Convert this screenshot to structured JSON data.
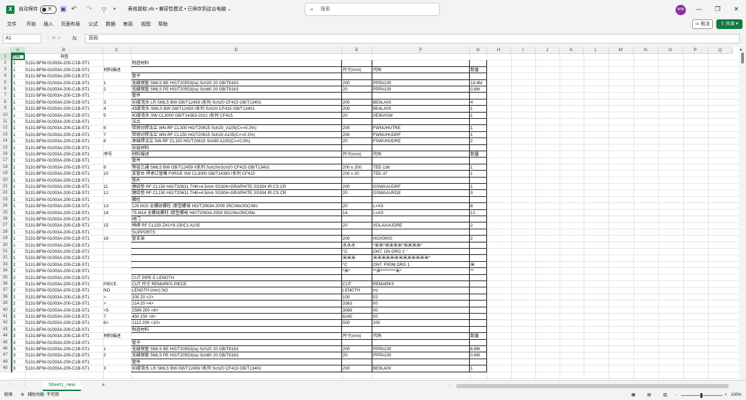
{
  "titlebar": {
    "app_logo": "X",
    "autosave_label": "自动保存",
    "autosave_state": "关",
    "filename": "表格提取.xls",
    "mode": "兼容性模式",
    "save_status": "已保存到这台电脑",
    "title_sep": "•",
    "search_placeholder": "搜索",
    "avatar_initials": "WW",
    "icons": [
      "save-icon",
      "undo-icon",
      "redo-icon",
      "filter-icon",
      "customize-icon",
      "minimize-icon",
      "restore-icon",
      "close-icon"
    ]
  },
  "menu": {
    "items": [
      "文件",
      "开始",
      "插入",
      "页面布局",
      "公式",
      "数据",
      "审阅",
      "视图",
      "帮助"
    ],
    "comment_btn": "批注",
    "share_btn": "共享"
  },
  "formula": {
    "namebox": "A1",
    "value": "页码"
  },
  "columns": [
    "A",
    "B",
    "C",
    "D",
    "E",
    "F",
    "G",
    "H",
    "I",
    "J",
    "K",
    "L",
    "M",
    "N",
    "O",
    "P",
    "Q"
  ],
  "rows": [
    [
      "页码",
      "书签",
      "",
      "",
      "",
      "",
      ""
    ],
    [
      "1",
      "5131-BFW-01003A-200-C1B-ST1",
      "",
      "制造材料",
      "",
      "",
      ""
    ],
    [
      "1",
      "5131-BFW-01003A-200-C1B-ST1",
      "材料描述",
      "",
      "尺寸(mm)",
      "代码",
      "数量"
    ],
    [
      "1",
      "5131-BFW-01003A-200-C1B-ST1",
      "",
      "管子",
      "",
      "",
      ""
    ],
    [
      "1",
      "5131-BFW-01003A-200-C1B-ST1",
      "1",
      "无缝钢管 SMLS BE HG/T20553(Ia) Sch20 20 GB/T8163",
      "200",
      "PPPA100",
      "18.4M"
    ],
    [
      "1",
      "5131-BFW-01003A-200-C1B-ST1",
      "2",
      "无缝钢管 SMLS PE HG/T20553(Ia) Sch80 20 GB/T8163",
      "20",
      "PPPA100",
      "0.6M"
    ],
    [
      "1",
      "5131-BFW-01003A-200-C1B-ST1",
      "",
      "管件",
      "",
      "",
      ""
    ],
    [
      "1",
      "5131-BFW-01003A-200-C1B-ST1",
      "3",
      "90度弯头 LR SMLS BW GB/T12459 I系列 Sch20 CF415 GB/T13401",
      "200",
      "BE9LA00",
      "4"
    ],
    [
      "1",
      "5131-BFW-01003A-200-C1B-ST1",
      "4",
      "45度弯头 SMLS BW GB/T12459 I系列 Sch20 CF415 GB/T13401",
      "200",
      "BE4LA00",
      "1"
    ],
    [
      "1",
      "5131-BFW-01003A-200-C1B-ST1",
      "5",
      "90度弯头 SW CL3000 GB/T14383-2021 I系列 CF415",
      "20",
      "0E90ASW",
      "1"
    ],
    [
      "1",
      "5131-BFW-01003A-200-C1B-ST1",
      "",
      "法兰",
      "",
      "",
      ""
    ],
    [
      "1",
      "5131-BFW-01003A-200-C1B-ST1",
      "6",
      "带颈对焊法兰 WN-RF CL300 HG/T20615 Sch20_A105(C<=0.3%)",
      "200",
      "FWNUHUTRE",
      "1"
    ],
    [
      "1",
      "5131-BFW-01003A-200-C1B-ST1",
      "7",
      "带颈对焊法兰 WN-RF CL150 HG/T20615 Sch20 A105(C<=0.3%)",
      "200",
      "FWNUHUDRF",
      "1"
    ],
    [
      "1",
      "5131-BFW-01003A-200-C1B-ST1",
      "8",
      "承插焊法兰 SW-RF CL150 HG/T20615 Sch80 A105(C<=0.3%)",
      "20",
      "FSWUHUDRE",
      "2"
    ],
    [
      "1",
      "5131-BFW-01003A-200-C1B-ST1",
      "",
      "安装材料",
      "",
      "",
      ""
    ],
    [
      "1",
      "5131-BFW-01003A-200-C1B-ST1",
      "序号",
      "材料描述",
      "尺寸(mm)",
      "代码",
      "数量"
    ],
    [
      "1",
      "5131-BFW-01003A-200-C1B-ST1",
      "",
      "管件",
      "",
      "",
      ""
    ],
    [
      "1",
      "5131-BFW-01003A-200-C1B-ST1",
      "9",
      "等径三通 SMLS BW GB/T12459 II系列 Sch20xSch20 CF415 GB/T13401",
      "200 x 200",
      "TEE-136",
      "1"
    ],
    [
      "1",
      "5131-BFW-01003A-200-C1B-ST1",
      "10",
      "支管台 焊承口管嘴 F0RGE SW CL3000 GB/T14383 I系列 CF415",
      "200 x 20",
      "TEE-37",
      "1"
    ],
    [
      "1",
      "5131-BFW-01003A-200-C1B-ST1",
      "",
      "垫片",
      "",
      "",
      ""
    ],
    [
      "1",
      "5131-BFW-01003A-200-C1B-ST1",
      "11",
      "缠绕垫 RF CL150 HG/T20631 THK=4.5mm SS304+GRAPHITE,SS304 IR CS CR",
      "200",
      "GSWAAUDRF",
      "1"
    ],
    [
      "1",
      "5131-BFW-01003A-200-C1B-ST1",
      "12",
      "缠绕垫 RF CL150 HG/T20631 THK=4.5mm SS304+GRAPHITE,SS304 IR CS CR",
      "20",
      "GSWAAURDE",
      "3"
    ],
    [
      "1",
      "5131-BFW-01003A-200-C1B-ST1",
      "",
      "螺栓",
      "",
      "",
      ""
    ],
    [
      "1",
      "5131-BFW-01003A-200-C1B-ST1",
      "13",
      "120 M20 全螺纹螺柱 /厚型螺母 HG/T20634-2009 35CrMo/30CrMo",
      "20",
      "L=XX",
      "8"
    ],
    [
      "1",
      "5131-BFW-01003A-200-C1B-ST1",
      "14",
      "75 M14 全螺纹螺柱 /厚型螺母 HG/T20634-2009 35CrMo/30CrMo",
      "14",
      "L=XX",
      "12"
    ],
    [
      "1",
      "5131-BFW-01003A-200-C1B-ST1",
      "",
      "阀门",
      "",
      "",
      ""
    ],
    [
      "1",
      "5131-BFW-01003A-200-C1B-ST1",
      "15",
      "闸阀 RF CL150 Z41Y8-150C1 A105",
      "20",
      "VGLAAAUDRE",
      "2"
    ],
    [
      "1",
      "5131-BFW-01003A-200-C1B-ST1",
      "",
      "SUPPORTS",
      "",
      "",
      ""
    ],
    [
      "1",
      "5131-BFW-01003A-200-C1B-ST1",
      "16",
      "管支架",
      "200",
      "HGX000S",
      "2"
    ],
    [
      "1",
      "5131-BFW-01003A-200-C1B-ST1",
      "",
      "",
      "水水水",
      "*米米*米米米米*米米米米*",
      ""
    ],
    [
      "1",
      "5131-BFW-01003A-200-C1B-ST1",
      "",
      "",
      "°C",
      "ONT. ON DRG 2 °",
      ""
    ],
    [
      "1",
      "5131-BFW-01003A-200-C1B-ST1",
      "",
      "",
      "米米米",
      "米米米米米米米米米米米米米*",
      ""
    ],
    [
      "2",
      "5131-BFW-01003A-200-C1B-ST1",
      "",
      "",
      "°C",
      "ONT. FR0M DRG 1",
      "米"
    ],
    [
      "2",
      "5131-BFW-01003A-200-C1B-ST1",
      "",
      "",
      "*米*",
      "**米*********米*",
      "**"
    ],
    [
      "2",
      "5131-BFW-01003A-200-C1B-ST1",
      "",
      "CUT PIPE E LENGTH",
      "",
      "",
      ""
    ],
    [
      "2",
      "5131-BFW-01003A-200-C1B-ST1",
      "PIECE",
      "CUT 尺寸 REMARKS PIECE",
      "CUT",
      "REMARKS",
      ""
    ],
    [
      "2",
      "5131-BFW-01003A-200-C1B-ST1",
      "NO",
      "LENGTH (mm) NO",
      "LENGTH",
      "m)",
      ""
    ],
    [
      "2",
      "5131-BFW-01003A-200-C1B-ST1",
      ">",
      "200 20 <2>",
      "100",
      "02",
      ""
    ],
    [
      "2",
      "5131-BFW-01003A-200-C1B-ST1",
      ">",
      "214 20 <4>",
      "3363",
      "00",
      ""
    ],
    [
      "2",
      "5131-BFW-01003A-200-C1B-ST1",
      "<5",
      "2586 200 <6>",
      "3066",
      "00",
      ""
    ],
    [
      "2",
      "5131-BFW-01003A-200-C1B-ST1",
      "7",
      "450 200 <8>",
      "6245",
      "00",
      ""
    ],
    [
      "2",
      "5131-BFW-01003A-200-C1B-ST1",
      "6>",
      "2112 200 <10>",
      "500",
      "200",
      ""
    ],
    [
      "3",
      "5131-BFW-01003A-200-C1B-ST1",
      "",
      "制造材料",
      "",
      "",
      ""
    ],
    [
      "3",
      "5131-BFW-01003A-200-C1B-ST1",
      "材料描述",
      "",
      "尺寸(mm)",
      "代码",
      "数量"
    ],
    [
      "3",
      "5131-BFW-01003A-200-C1B-ST1",
      "",
      "管子",
      "",
      "",
      ""
    ],
    [
      "3",
      "5131-BFW-01003A-200-C1B-ST1",
      "1",
      "无缝钢管 SMLS BE HG/T20553(Ia) Sch20 20 GB/T8163",
      "200",
      "PPPA100",
      "6.8M"
    ],
    [
      "3",
      "5131-BFW-01003A-200-C1B-ST1",
      "2",
      "无缝钢管 SMLS PE HG/T20553(Ia) Sch80 20 GB/T8163",
      "20",
      "PPPA100",
      "0.6M"
    ],
    [
      "3",
      "5131-BFW-01003A-200-C1B-ST1",
      "",
      "管件",
      "",
      "",
      ""
    ],
    [
      "3",
      "5131-BFW-01003A-200-C1B-ST1",
      "3",
      "90度弯头 LR SMLS BW GB/T12459 I系列 Sch20 CF415 GB/T13401",
      "200",
      "BE9LA00",
      "1"
    ]
  ],
  "tabs": {
    "sheet_name": "Sheet1_new",
    "add": "+"
  },
  "status": {
    "ready": "就绪",
    "accessibility": "辅助功能: 不可用",
    "zoom_minus": "-",
    "zoom_plus": "+",
    "zoom": "100%"
  }
}
